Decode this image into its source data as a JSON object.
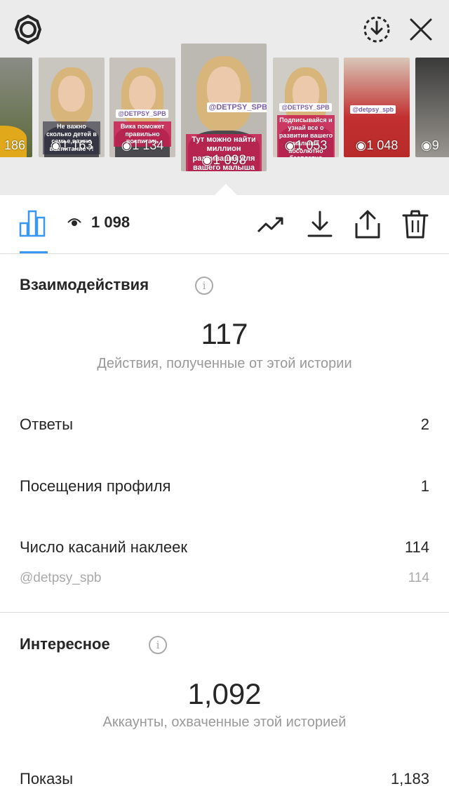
{
  "thumbnails": [
    {
      "views": "186",
      "caption": "",
      "tag": ""
    },
    {
      "views": "1 163",
      "caption": "Не важно сколько детей в семье,важно воспитание ?!",
      "tag": ""
    },
    {
      "views": "1 134",
      "caption": "Вика поможет правильно воспитать",
      "tag": "@DETPSY_SPB"
    },
    {
      "views": "1 098",
      "caption": "Тут можно найти миллион развивашек для вашего малыша",
      "tag": "@DETPSY_SPB"
    },
    {
      "views": "1 053",
      "caption": "Подписывайся и узнай все о развитии вашего малыша абсолютно бесплатно",
      "tag": "@DETPSY_SPB"
    },
    {
      "views": "1 048",
      "caption": "",
      "tag": "@detpsy_spb"
    },
    {
      "views": "9",
      "caption": "",
      "tag": ""
    }
  ],
  "toolbar": {
    "view_count": "1 098"
  },
  "interactions": {
    "title": "Взаимодействия",
    "total": "117",
    "caption": "Действия, полученные от этой истории",
    "rows": [
      {
        "label": "Ответы",
        "value": "2"
      },
      {
        "label": "Посещения профиля",
        "value": "1"
      },
      {
        "label": "Число касаний наклеек",
        "value": "114"
      }
    ],
    "sub_label": "@detpsy_spb",
    "sub_value": "114"
  },
  "discovery": {
    "title": "Интересное",
    "total": "1,092",
    "caption": "Аккаунты, охваченные этой историей",
    "rows": [
      {
        "label": "Показы",
        "value": "1,183"
      }
    ]
  },
  "colors": {
    "accent": "#3897f0",
    "topbar_bg": "#ebebeb",
    "muted_text": "#999999"
  }
}
